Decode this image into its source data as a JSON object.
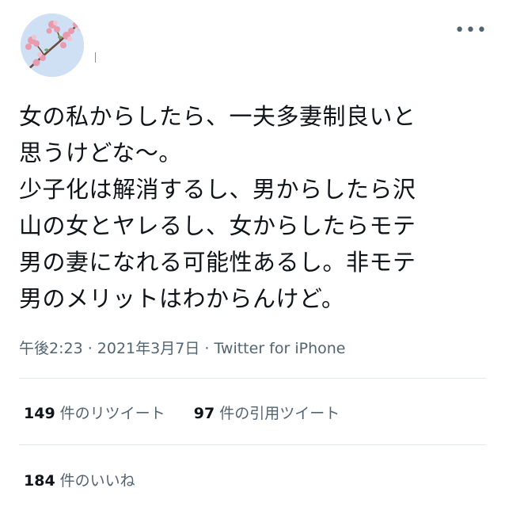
{
  "tweet": {
    "lines": [
      "女の私からしたら、一夫多妻制良いと",
      "思うけどな〜。",
      "少子化は解消するし、男からしたら沢",
      "山の女とヤレるし、女からしたらモテ",
      "男の妻になれる可能性あるし。非モテ",
      "男のメリットはわからんけど。"
    ]
  },
  "meta": {
    "time": "午後2:23",
    "sep1": " · ",
    "date": "2021年3月7日",
    "sep2": " · ",
    "source": "Twitter for iPhone"
  },
  "stats": {
    "retweets": {
      "count": "149",
      "label": "件のリツイート"
    },
    "quotes": {
      "count": "97",
      "label": "件の引用ツイート"
    },
    "likes": {
      "count": "184",
      "label": "件のいいね"
    }
  },
  "icons": {
    "more": "more-horizontal-icon",
    "avatar": "cherry-blossom-avatar"
  },
  "colors": {
    "text": "#0f1419",
    "muted": "#536471",
    "divider": "#e1e8ed"
  }
}
